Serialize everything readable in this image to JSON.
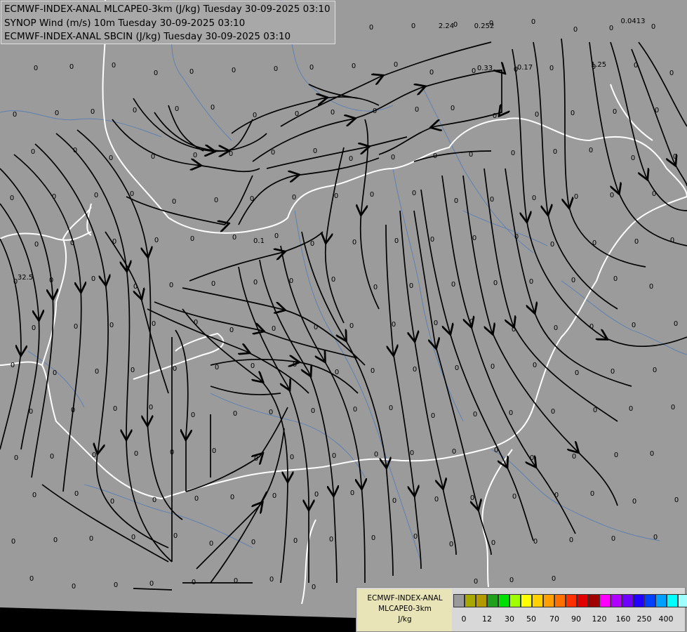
{
  "header": {
    "line1": "ECMWF-INDEX-ANAL MLCAPE0-3km (J/kg) Tuesday 30-09-2025 03:10",
    "line2": "SYNOP Wind (m/s) 10m Tuesday 30-09-2025 03:10",
    "line3": "ECMWF-INDEX-ANAL SBCIN (J/kg) Tuesday 30-09-2025 03:10"
  },
  "legend": {
    "line1": "ECMWF-INDEX-ANAL",
    "line2": "MLCAPE0-3km",
    "line3": "J/kg",
    "colors": [
      "#9a9a9a",
      "#a8a800",
      "#b49a00",
      "#1ea01e",
      "#00e000",
      "#a0ff00",
      "#ffff00",
      "#ffd000",
      "#ffa000",
      "#ff7000",
      "#ff3000",
      "#e00000",
      "#a00000",
      "#ff00ff",
      "#b000ff",
      "#7000ff",
      "#2000ff",
      "#0040ff",
      "#00a0ff",
      "#00ffff",
      "#a0ffff",
      "#ffffff"
    ],
    "ticks": [
      "0",
      "12",
      "30",
      "50",
      "70",
      "90",
      "120",
      "160",
      "250",
      "400"
    ]
  },
  "map": {
    "nonzero_values": [
      "2.24",
      "0.252",
      "0.0413",
      "0.33",
      "0.17",
      "1.25",
      "32.5",
      "0.1"
    ],
    "zero_label": "0"
  }
}
